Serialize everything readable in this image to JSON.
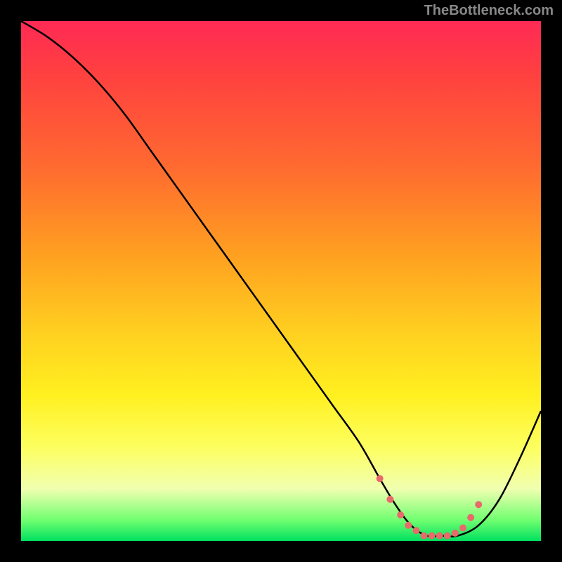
{
  "attribution": "TheBottleneck.com",
  "chart_data": {
    "type": "line",
    "title": "",
    "xlabel": "",
    "ylabel": "",
    "xlim": [
      0,
      100
    ],
    "ylim": [
      0,
      100
    ],
    "series": [
      {
        "name": "bottleneck-curve",
        "x": [
          0,
          5,
          10,
          15,
          20,
          25,
          30,
          35,
          40,
          45,
          50,
          55,
          60,
          65,
          69,
          72,
          75,
          78,
          81,
          84,
          88,
          92,
          96,
          100
        ],
        "y": [
          100,
          97,
          93,
          88,
          82,
          75,
          68,
          61,
          54,
          47,
          40,
          33,
          26,
          19,
          12,
          7,
          3,
          1,
          1,
          1,
          3,
          8,
          16,
          25
        ]
      }
    ],
    "dot_region": {
      "name": "optimal-range",
      "x": [
        69,
        71,
        73,
        74.5,
        76,
        77.5,
        79,
        80.5,
        82,
        83.5,
        85,
        86.5,
        88
      ],
      "y": [
        12,
        8,
        5,
        3,
        2,
        1,
        1,
        1,
        1,
        1.5,
        2.5,
        4.5,
        7
      ]
    },
    "gradient_bands": [
      {
        "color": "#ff2a55",
        "stop": 0.0
      },
      {
        "color": "#ff4040",
        "stop": 0.1
      },
      {
        "color": "#ff6a30",
        "stop": 0.28
      },
      {
        "color": "#ffa020",
        "stop": 0.45
      },
      {
        "color": "#ffd020",
        "stop": 0.6
      },
      {
        "color": "#fff020",
        "stop": 0.72
      },
      {
        "color": "#fdff60",
        "stop": 0.82
      },
      {
        "color": "#f0ffb0",
        "stop": 0.9
      },
      {
        "color": "#70ff70",
        "stop": 0.96
      },
      {
        "color": "#00e060",
        "stop": 1.0
      }
    ],
    "line_color": "#000000",
    "dot_color": "#e86a6a"
  }
}
